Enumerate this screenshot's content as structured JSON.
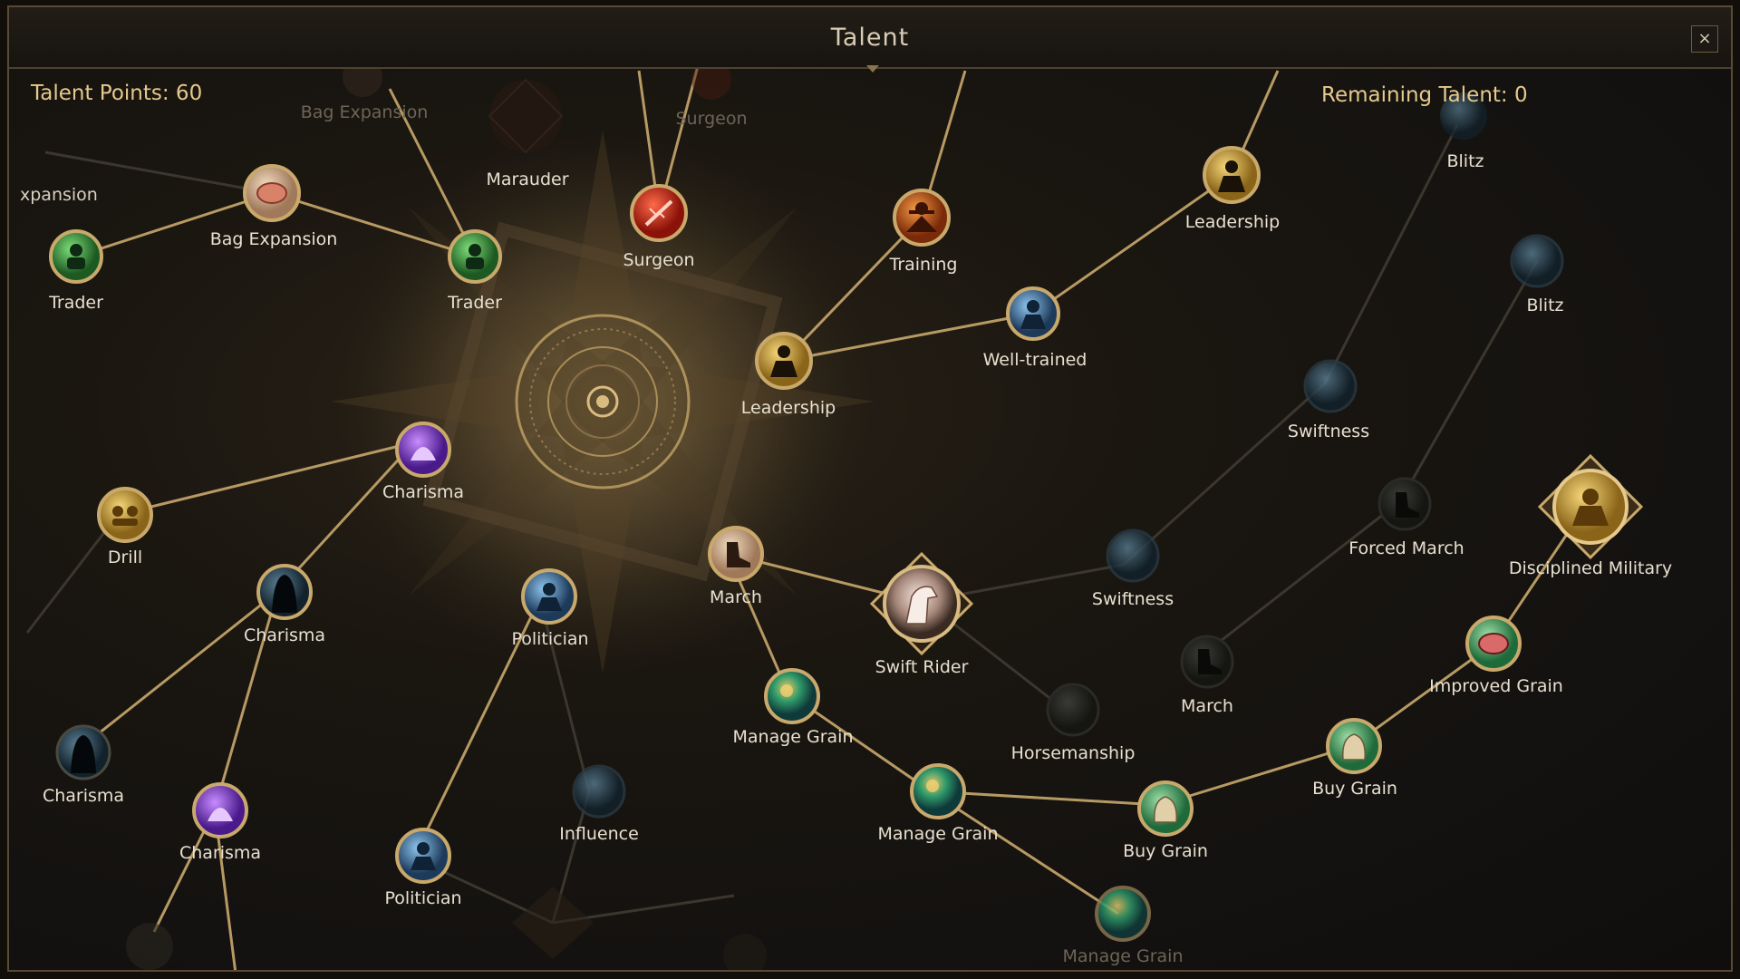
{
  "window": {
    "title": "Talent",
    "close_label": "×"
  },
  "header": {
    "talent_points": "Talent Points: 60",
    "remaining_talent": "Remaining Talent: 0"
  },
  "nodes": {
    "bag_expansion_top": {
      "label": "Bag Expansion",
      "state": "dim"
    },
    "surgeon_top": {
      "label": "Surgeon",
      "state": "dim"
    },
    "expansion_left": {
      "label": "xpansion",
      "state": "mid"
    },
    "marauder": {
      "label": "Marauder",
      "state": "locked"
    },
    "bag_expansion": {
      "label": "Bag Expansion",
      "state": "unlocked",
      "icon": "meat-icon"
    },
    "trader_left": {
      "label": "Trader",
      "state": "unlocked",
      "icon": "trader-icon"
    },
    "trader_right": {
      "label": "Trader",
      "state": "unlocked",
      "icon": "trader-icon"
    },
    "surgeon": {
      "label": "Surgeon",
      "state": "unlocked",
      "icon": "surgeon-icon"
    },
    "training": {
      "label": "Training",
      "state": "unlocked",
      "icon": "training-icon"
    },
    "leadership_top": {
      "label": "Leadership",
      "state": "unlocked",
      "icon": "leader-icon"
    },
    "well_trained": {
      "label": "Well-trained",
      "state": "unlocked",
      "icon": "soldier-icon"
    },
    "leadership_center": {
      "label": "Leadership",
      "state": "unlocked",
      "icon": "leader-icon"
    },
    "blitz_top": {
      "label": "Blitz",
      "state": "locked"
    },
    "blitz_right": {
      "label": "Blitz",
      "state": "locked"
    },
    "swiftness_upper": {
      "label": "Swiftness",
      "state": "locked"
    },
    "forced_march": {
      "label": "Forced March",
      "state": "locked"
    },
    "disciplined_military": {
      "label": "Disciplined Military",
      "state": "unlocked",
      "icon": "military-icon"
    },
    "charisma_top": {
      "label": "Charisma",
      "state": "unlocked",
      "icon": "charisma-icon"
    },
    "drill": {
      "label": "Drill",
      "state": "unlocked",
      "icon": "drill-icon"
    },
    "charisma_mid": {
      "label": "Charisma",
      "state": "unlocked",
      "icon": "hood-icon"
    },
    "politician_top": {
      "label": "Politician",
      "state": "unlocked",
      "icon": "politician-icon"
    },
    "march": {
      "label": "March",
      "state": "unlocked",
      "icon": "boot-icon"
    },
    "swift_rider": {
      "label": "Swift Rider",
      "state": "unlocked",
      "icon": "horse-icon"
    },
    "swiftness_lower": {
      "label": "Swiftness",
      "state": "locked"
    },
    "march_right": {
      "label": "March",
      "state": "locked"
    },
    "improved_grain": {
      "label": "Improved Grain",
      "state": "unlocked",
      "icon": "meat-icon"
    },
    "manage_grain_1": {
      "label": "Manage Grain",
      "state": "unlocked",
      "icon": "grain-icon"
    },
    "horsemanship": {
      "label": "Horsemanship",
      "state": "locked"
    },
    "buy_grain_right": {
      "label": "Buy Grain",
      "state": "unlocked",
      "icon": "sack-icon"
    },
    "charisma_low_left": {
      "label": "Charisma",
      "state": "locked"
    },
    "influence": {
      "label": "Influence",
      "state": "locked"
    },
    "manage_grain_2": {
      "label": "Manage Grain",
      "state": "unlocked",
      "icon": "grain-icon"
    },
    "buy_grain_mid": {
      "label": "Buy Grain",
      "state": "unlocked",
      "icon": "sack-icon"
    },
    "charisma_bottom": {
      "label": "Charisma",
      "state": "unlocked",
      "icon": "charisma-icon"
    },
    "politician_bottom": {
      "label": "Politician",
      "state": "unlocked",
      "icon": "politician-icon"
    },
    "manage_grain_3": {
      "label": "Manage Grain",
      "state": "dim",
      "icon": "grain-icon"
    }
  },
  "colors": {
    "accent_gold": "#e6c98c",
    "active_link": "#c9a96b",
    "inactive_link": "#3a352d",
    "label_text": "#e8e0d0"
  }
}
